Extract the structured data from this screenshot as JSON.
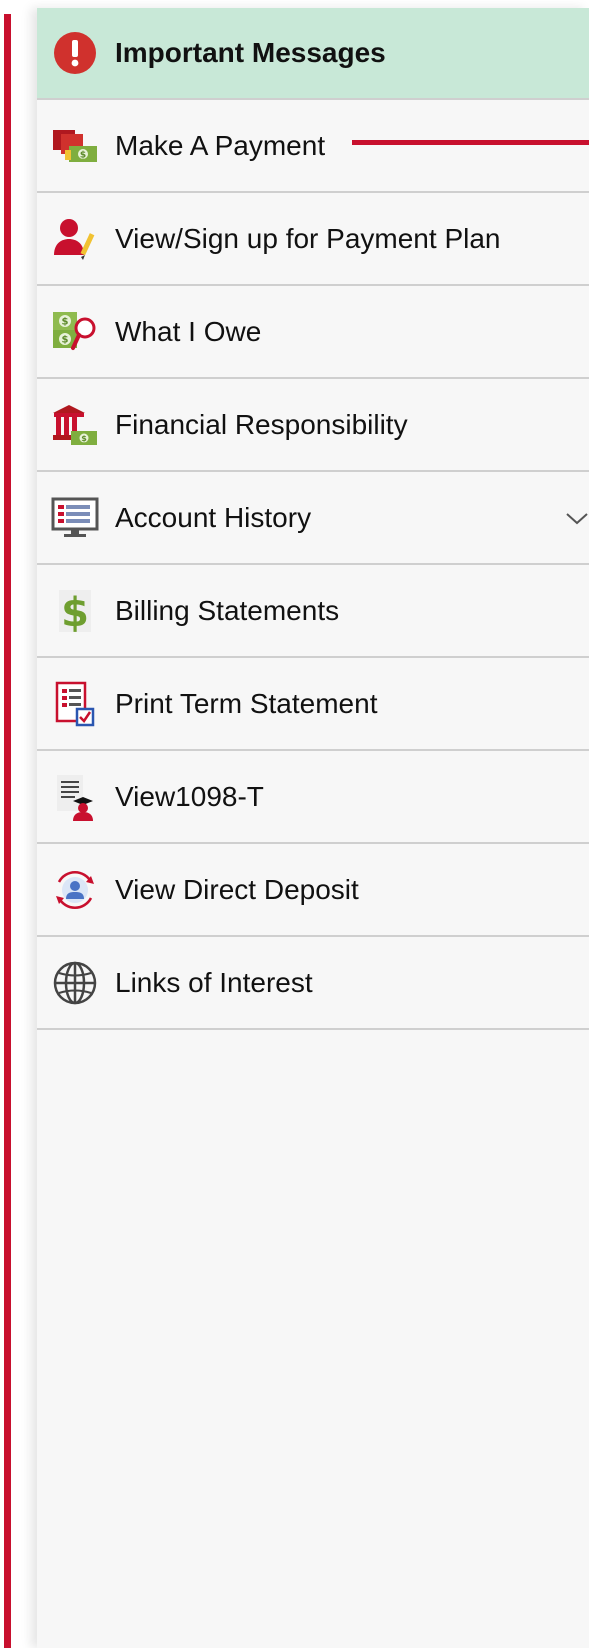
{
  "menu": {
    "items": [
      {
        "label": "Important Messages",
        "icon": "exclamation-circle-icon"
      },
      {
        "label": "Make A Payment",
        "icon": "payment-cards-icon"
      },
      {
        "label": "View/Sign up for Payment Plan",
        "icon": "user-pencil-icon"
      },
      {
        "label": "What I Owe",
        "icon": "money-magnifier-icon"
      },
      {
        "label": "Financial Responsibility",
        "icon": "bank-money-icon"
      },
      {
        "label": "Account History",
        "icon": "monitor-list-icon"
      },
      {
        "label": "Billing Statements",
        "icon": "dollar-sign-icon"
      },
      {
        "label": "Print Term Statement",
        "icon": "document-checkbox-icon"
      },
      {
        "label": "View1098-T",
        "icon": "document-graduate-icon"
      },
      {
        "label": "View Direct Deposit",
        "icon": "deposit-person-cycle-icon"
      },
      {
        "label": "Links of Interest",
        "icon": "globe-icon"
      }
    ]
  },
  "colors": {
    "accent_red": "#c8102e",
    "highlight_green": "#c8e8d7",
    "panel_bg": "#f7f7f7",
    "divider": "#cfcfcf"
  }
}
